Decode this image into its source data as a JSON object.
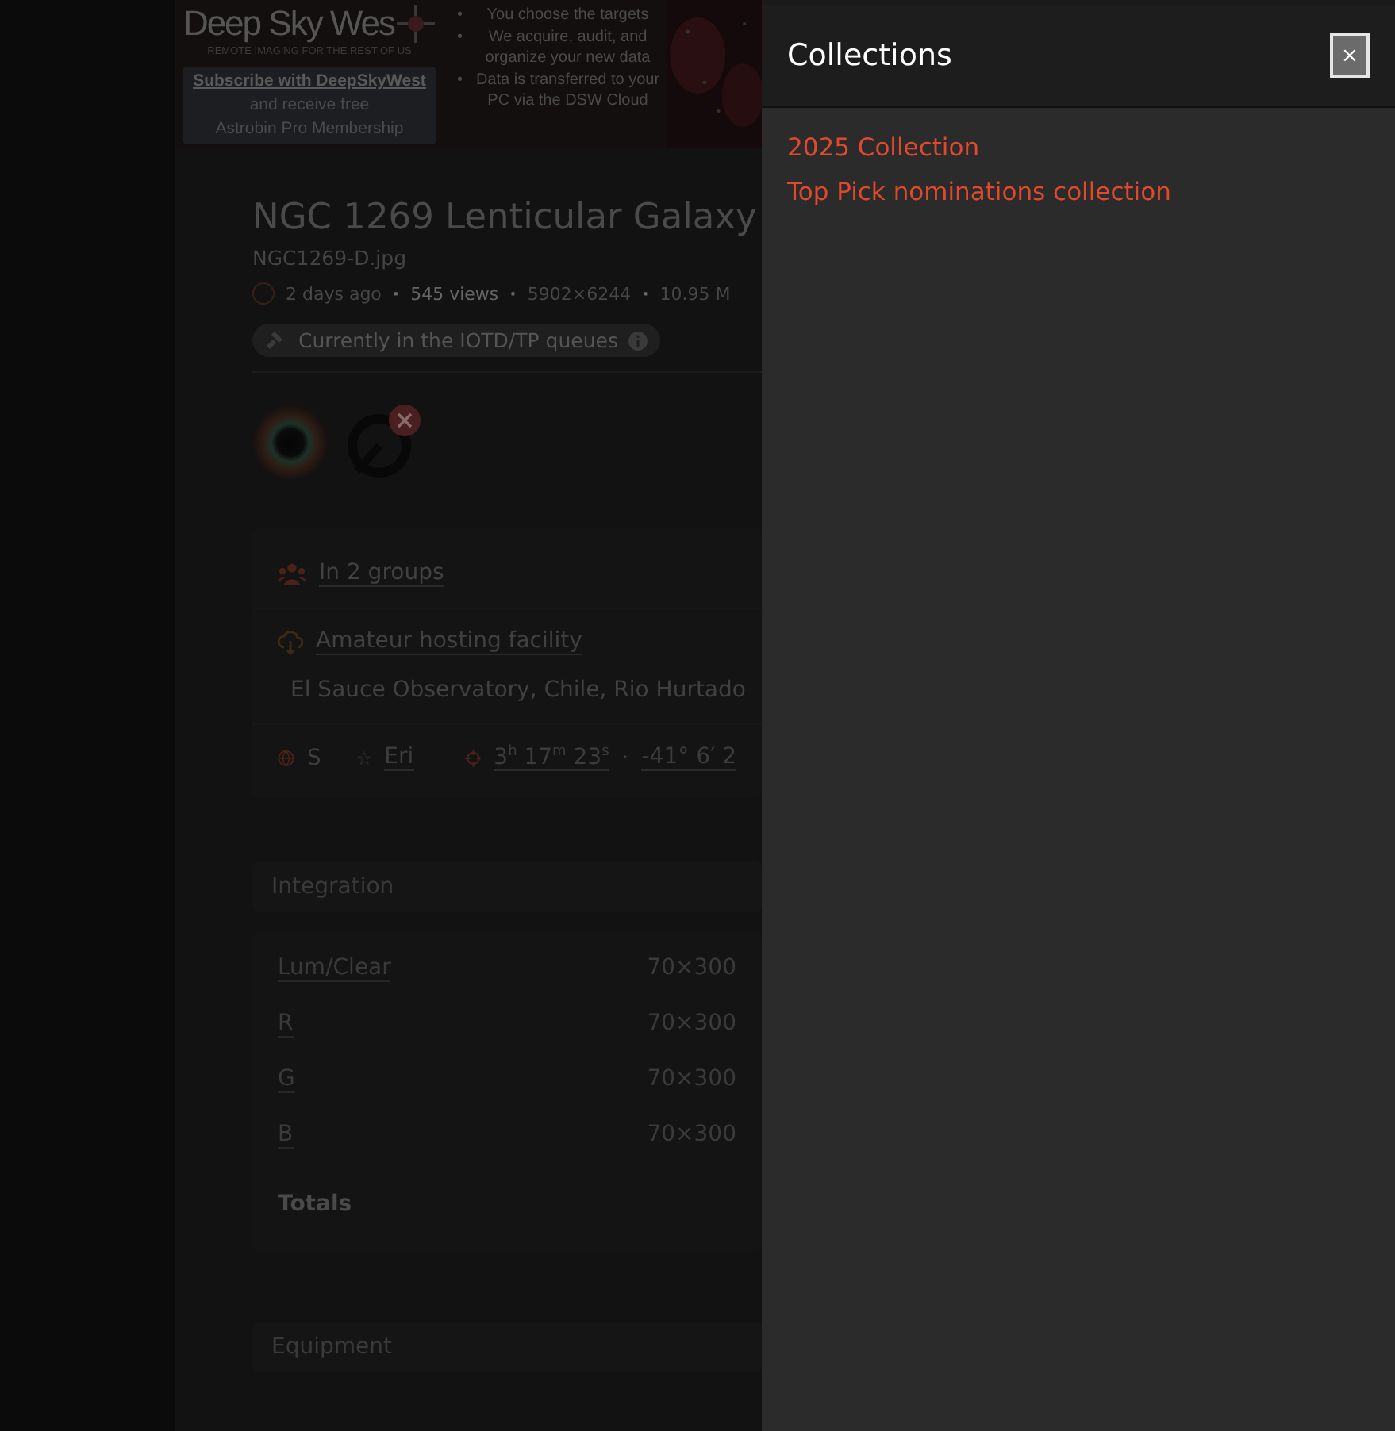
{
  "ad": {
    "logo": "Deep Sky Wes",
    "tagline": "REMOTE IMAGING FOR THE REST OF US",
    "subscribe_link": "Subscribe with DeepSkyWest",
    "subscribe_lines": [
      "and receive free",
      "Astrobin Pro Membership"
    ],
    "bullets": [
      {
        "marker": "•",
        "text": "You choose the targets"
      },
      {
        "marker": "•",
        "text": "We acquire, audit, and organize your new data"
      },
      {
        "marker": "•",
        "text": "Data is transferred to your PC via the DSW Cloud"
      }
    ]
  },
  "image": {
    "title": "NGC 1269 Lenticular Galaxy",
    "filename": "NGC1269-D.jpg",
    "meta": [
      {
        "kind": "text",
        "text": "2 days ago"
      },
      {
        "kind": "separator",
        "text": "·"
      },
      {
        "kind": "strong",
        "text": "545 views"
      },
      {
        "kind": "separator",
        "text": "·"
      },
      {
        "kind": "text",
        "text": "5902×6244"
      },
      {
        "kind": "separator",
        "text": "·"
      },
      {
        "kind": "text",
        "text": "10.95 M"
      }
    ],
    "queue_badge": "Currently in the IOTD/TP queues",
    "groups": "In 2 groups",
    "hosting": "Amateur hosting facility",
    "location": "El Sauce Observatory, Chile, Rio Hurtado",
    "hemisphere": "S",
    "constellation": "Eri",
    "ra": "3$^{h}$ 17$^{m}$ 23$^{s}$",
    "separator": "·",
    "dec": "-41° 6′ 2"
  },
  "integration": {
    "title": "Integration",
    "rows": [
      {
        "filter": "Lum/Clear",
        "value": "70×300"
      },
      {
        "filter": "R",
        "value": "70×300"
      },
      {
        "filter": "G",
        "value": "70×300"
      },
      {
        "filter": "B",
        "value": "70×300"
      }
    ],
    "totals": "Totals"
  },
  "equipment": {
    "title": "Equipment"
  },
  "panel": {
    "title": "Collections",
    "close": "×",
    "items": [
      "2025 Collection",
      "Top Pick nominations collection"
    ]
  }
}
